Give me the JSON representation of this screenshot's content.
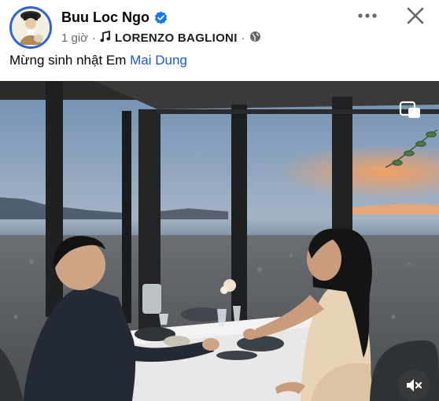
{
  "post": {
    "author": "Buu Loc Ngo",
    "time": "1 giờ",
    "separator": "·",
    "song": "LORENZO BAGLIONI",
    "privacy_icon": "globe-icon",
    "caption_text": "Mừng sinh nhật Em ",
    "caption_tag": "Mai Dung"
  },
  "icons": {
    "verified": "verified-badge-icon",
    "music": "music-note-icon",
    "more": "more-options-icon",
    "close": "close-icon",
    "mute": "volume-mute-icon",
    "expand": "expand-icon"
  },
  "colors": {
    "verified": "#1877f2",
    "tag": "#1a59d6",
    "meta": "#65676b"
  }
}
